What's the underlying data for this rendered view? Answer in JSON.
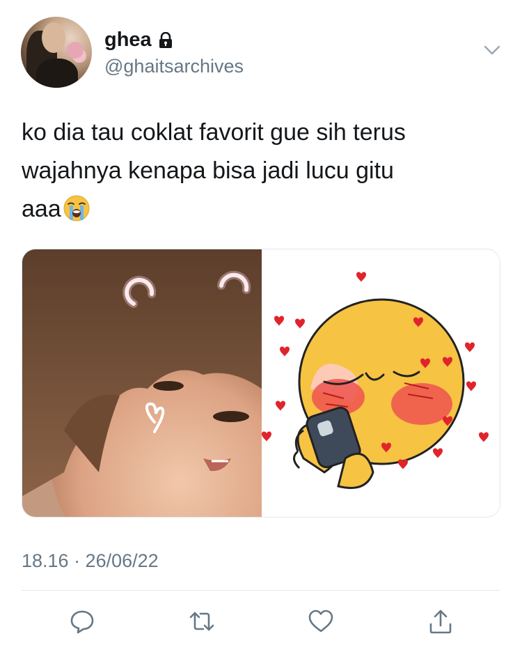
{
  "user": {
    "display_name": "ghea",
    "handle": "@ghaitsarchives",
    "protected_icon": "lock-icon",
    "menu_icon": "chevron-down-icon"
  },
  "tweet": {
    "text_line1": "ko dia tau coklat favorit gue sih terus",
    "text_line2": "wajahnya kenapa bisa jadi lucu gitu",
    "text_line3": "aaa",
    "emoji": "loudly-crying-face",
    "timestamp": "18.16 · 26/06/22"
  },
  "media": {
    "left": "photo of a person with glowing doodles",
    "right": "blushing emoji holding a phone surrounded by hearts"
  },
  "actions": [
    {
      "icon": "reply-icon"
    },
    {
      "icon": "retweet-icon"
    },
    {
      "icon": "like-icon"
    },
    {
      "icon": "share-icon"
    }
  ],
  "colors": {
    "text": "#14171a",
    "secondary": "#657786",
    "accent": "#1da1f2",
    "heart_red": "#e0242c",
    "emoji_yellow": "#f6c343"
  }
}
